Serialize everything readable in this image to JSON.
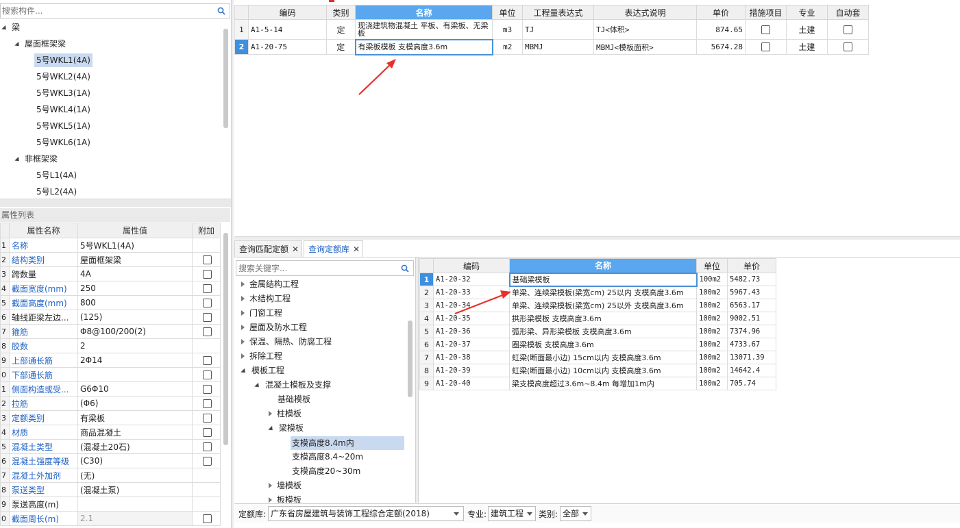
{
  "left_search": {
    "placeholder": "搜索构件..."
  },
  "component_tree": {
    "root": "梁",
    "group1": "屋面框架梁",
    "group1_items": [
      "5号WKL1(4A)",
      "5号WKL2(4A)",
      "5号WKL3(1A)",
      "5号WKL4(1A)",
      "5号WKL5(1A)",
      "5号WKL6(1A)"
    ],
    "group2": "非框架梁",
    "group2_items": [
      "5号L1(4A)",
      "5号L2(4A)"
    ]
  },
  "properties": {
    "panel_title": "属性列表",
    "headers": [
      "属性名称",
      "属性值",
      "附加"
    ],
    "rows": [
      {
        "no": "1",
        "name": "名称",
        "value": "5号WKL1(4A)",
        "link": true,
        "cb": false
      },
      {
        "no": "2",
        "name": "结构类别",
        "value": "屋面框架梁",
        "link": true,
        "cb": true
      },
      {
        "no": "3",
        "name": "跨数量",
        "value": "4A",
        "link": false,
        "cb": true
      },
      {
        "no": "4",
        "name": "截面宽度(mm)",
        "value": "250",
        "link": true,
        "cb": true
      },
      {
        "no": "5",
        "name": "截面高度(mm)",
        "value": "800",
        "link": true,
        "cb": true
      },
      {
        "no": "6",
        "name": "轴线距梁左边...",
        "value": "(125)",
        "link": false,
        "cb": true
      },
      {
        "no": "7",
        "name": "箍筋",
        "value": "Φ8@100/200(2)",
        "link": true,
        "cb": true
      },
      {
        "no": "8",
        "name": "胶数",
        "value": "2",
        "link": true,
        "cb": false
      },
      {
        "no": "9",
        "name": "上部通长筋",
        "value": "2Φ14",
        "link": true,
        "cb": true
      },
      {
        "no": "0",
        "name": "下部通长筋",
        "value": "",
        "link": true,
        "cb": true
      },
      {
        "no": "1",
        "name": "侧面构造或受...",
        "value": "G6Φ10",
        "link": true,
        "cb": true
      },
      {
        "no": "2",
        "name": "拉筋",
        "value": "(Φ6)",
        "link": true,
        "cb": true
      },
      {
        "no": "3",
        "name": "定额类别",
        "value": "有梁板",
        "link": true,
        "cb": true
      },
      {
        "no": "4",
        "name": "材质",
        "value": "商品混凝土",
        "link": true,
        "cb": true
      },
      {
        "no": "5",
        "name": "混凝土类型",
        "value": "(混凝土20石)",
        "link": true,
        "cb": true
      },
      {
        "no": "6",
        "name": "混凝土强度等级",
        "value": "(C30)",
        "link": true,
        "cb": true
      },
      {
        "no": "7",
        "name": "混凝土外加剂",
        "value": "(无)",
        "link": true,
        "cb": false
      },
      {
        "no": "8",
        "name": "泵送类型",
        "value": "(混凝土泵)",
        "link": true,
        "cb": false
      },
      {
        "no": "9",
        "name": "泵送高度(m)",
        "value": "",
        "link": false,
        "cb": false
      },
      {
        "no": "0",
        "name": "截面周长(m)",
        "value": "2.1",
        "link": true,
        "cb": true
      }
    ]
  },
  "quota_table": {
    "headers": [
      "编码",
      "类别",
      "名称",
      "单位",
      "工程量表达式",
      "表达式说明",
      "单价",
      "措施项目",
      "专业",
      "自动套"
    ],
    "rows": [
      {
        "no": "1",
        "code": "A1-5-14",
        "type": "定",
        "name": "现浇建筑物混凝土 平板、有梁板、无梁板",
        "unit": "m3",
        "expr": "TJ",
        "desc": "TJ<体积>",
        "price": "874.65",
        "major": "土建"
      },
      {
        "no": "2",
        "code": "A1-20-75",
        "type": "定",
        "name": "有梁板模板 支模高度3.6m",
        "unit": "m2",
        "expr": "MBMJ",
        "desc": "MBMJ<模板面积>",
        "price": "5674.28",
        "major": "土建"
      }
    ]
  },
  "tabs": [
    {
      "label": "查询匹配定额"
    },
    {
      "label": "查询定额库"
    }
  ],
  "lib_search": {
    "placeholder": "搜索关键字..."
  },
  "lib_tree": {
    "items": [
      "金属结构工程",
      "木结构工程",
      "门窗工程",
      "屋面及防水工程",
      "保温、隔热、防腐工程",
      "拆除工程",
      "模板工程",
      "混凝土模板及支撑",
      "基础模板",
      "柱模板",
      "梁模板",
      "支模高度8.4m内",
      "支模高度8.4~20m",
      "支模高度20~30m",
      "墙模板",
      "板模板"
    ]
  },
  "lib_table": {
    "headers": [
      "编码",
      "名称",
      "单位",
      "单价"
    ],
    "rows": [
      {
        "no": "1",
        "code": "A1-20-32",
        "name": "基础梁模板",
        "unit": "100m2",
        "price": "5482.73"
      },
      {
        "no": "2",
        "code": "A1-20-33",
        "name": "单梁、连续梁模板(梁宽cm) 25以内 支模高度3.6m",
        "unit": "100m2",
        "price": "5967.43"
      },
      {
        "no": "3",
        "code": "A1-20-34",
        "name": "单梁、连续梁模板(梁宽cm) 25以外 支模高度3.6m",
        "unit": "100m2",
        "price": "6563.17"
      },
      {
        "no": "4",
        "code": "A1-20-35",
        "name": "拱形梁模板 支模高度3.6m",
        "unit": "100m2",
        "price": "9002.51"
      },
      {
        "no": "5",
        "code": "A1-20-36",
        "name": "弧形梁、异形梁模板 支模高度3.6m",
        "unit": "100m2",
        "price": "7374.96"
      },
      {
        "no": "6",
        "code": "A1-20-37",
        "name": "圈梁模板 支模高度3.6m",
        "unit": "100m2",
        "price": "4733.67"
      },
      {
        "no": "7",
        "code": "A1-20-38",
        "name": "虹梁(断面最小边) 15cm以内 支模高度3.6m",
        "unit": "100m2",
        "price": "13071.39"
      },
      {
        "no": "8",
        "code": "A1-20-39",
        "name": "虹梁(断面最小边) 10cm以内 支模高度3.6m",
        "unit": "100m2",
        "price": "14642.4"
      },
      {
        "no": "9",
        "code": "A1-20-40",
        "name": "梁支模高度超过3.6m~8.4m 每增加1m内",
        "unit": "100m2",
        "price": "705.74"
      }
    ]
  },
  "bottom_bar": {
    "lib_label": "定额库:",
    "lib_value": "广东省房屋建筑与装饰工程综合定额(2018)",
    "major_label": "专业:",
    "major_value": "建筑工程",
    "type_label": "类别:",
    "type_value": "全部"
  },
  "colors": {
    "accent": "#5aa7ef",
    "link": "#1f62c6",
    "arrow": "#e8302a",
    "selection": "#c9daf0"
  }
}
